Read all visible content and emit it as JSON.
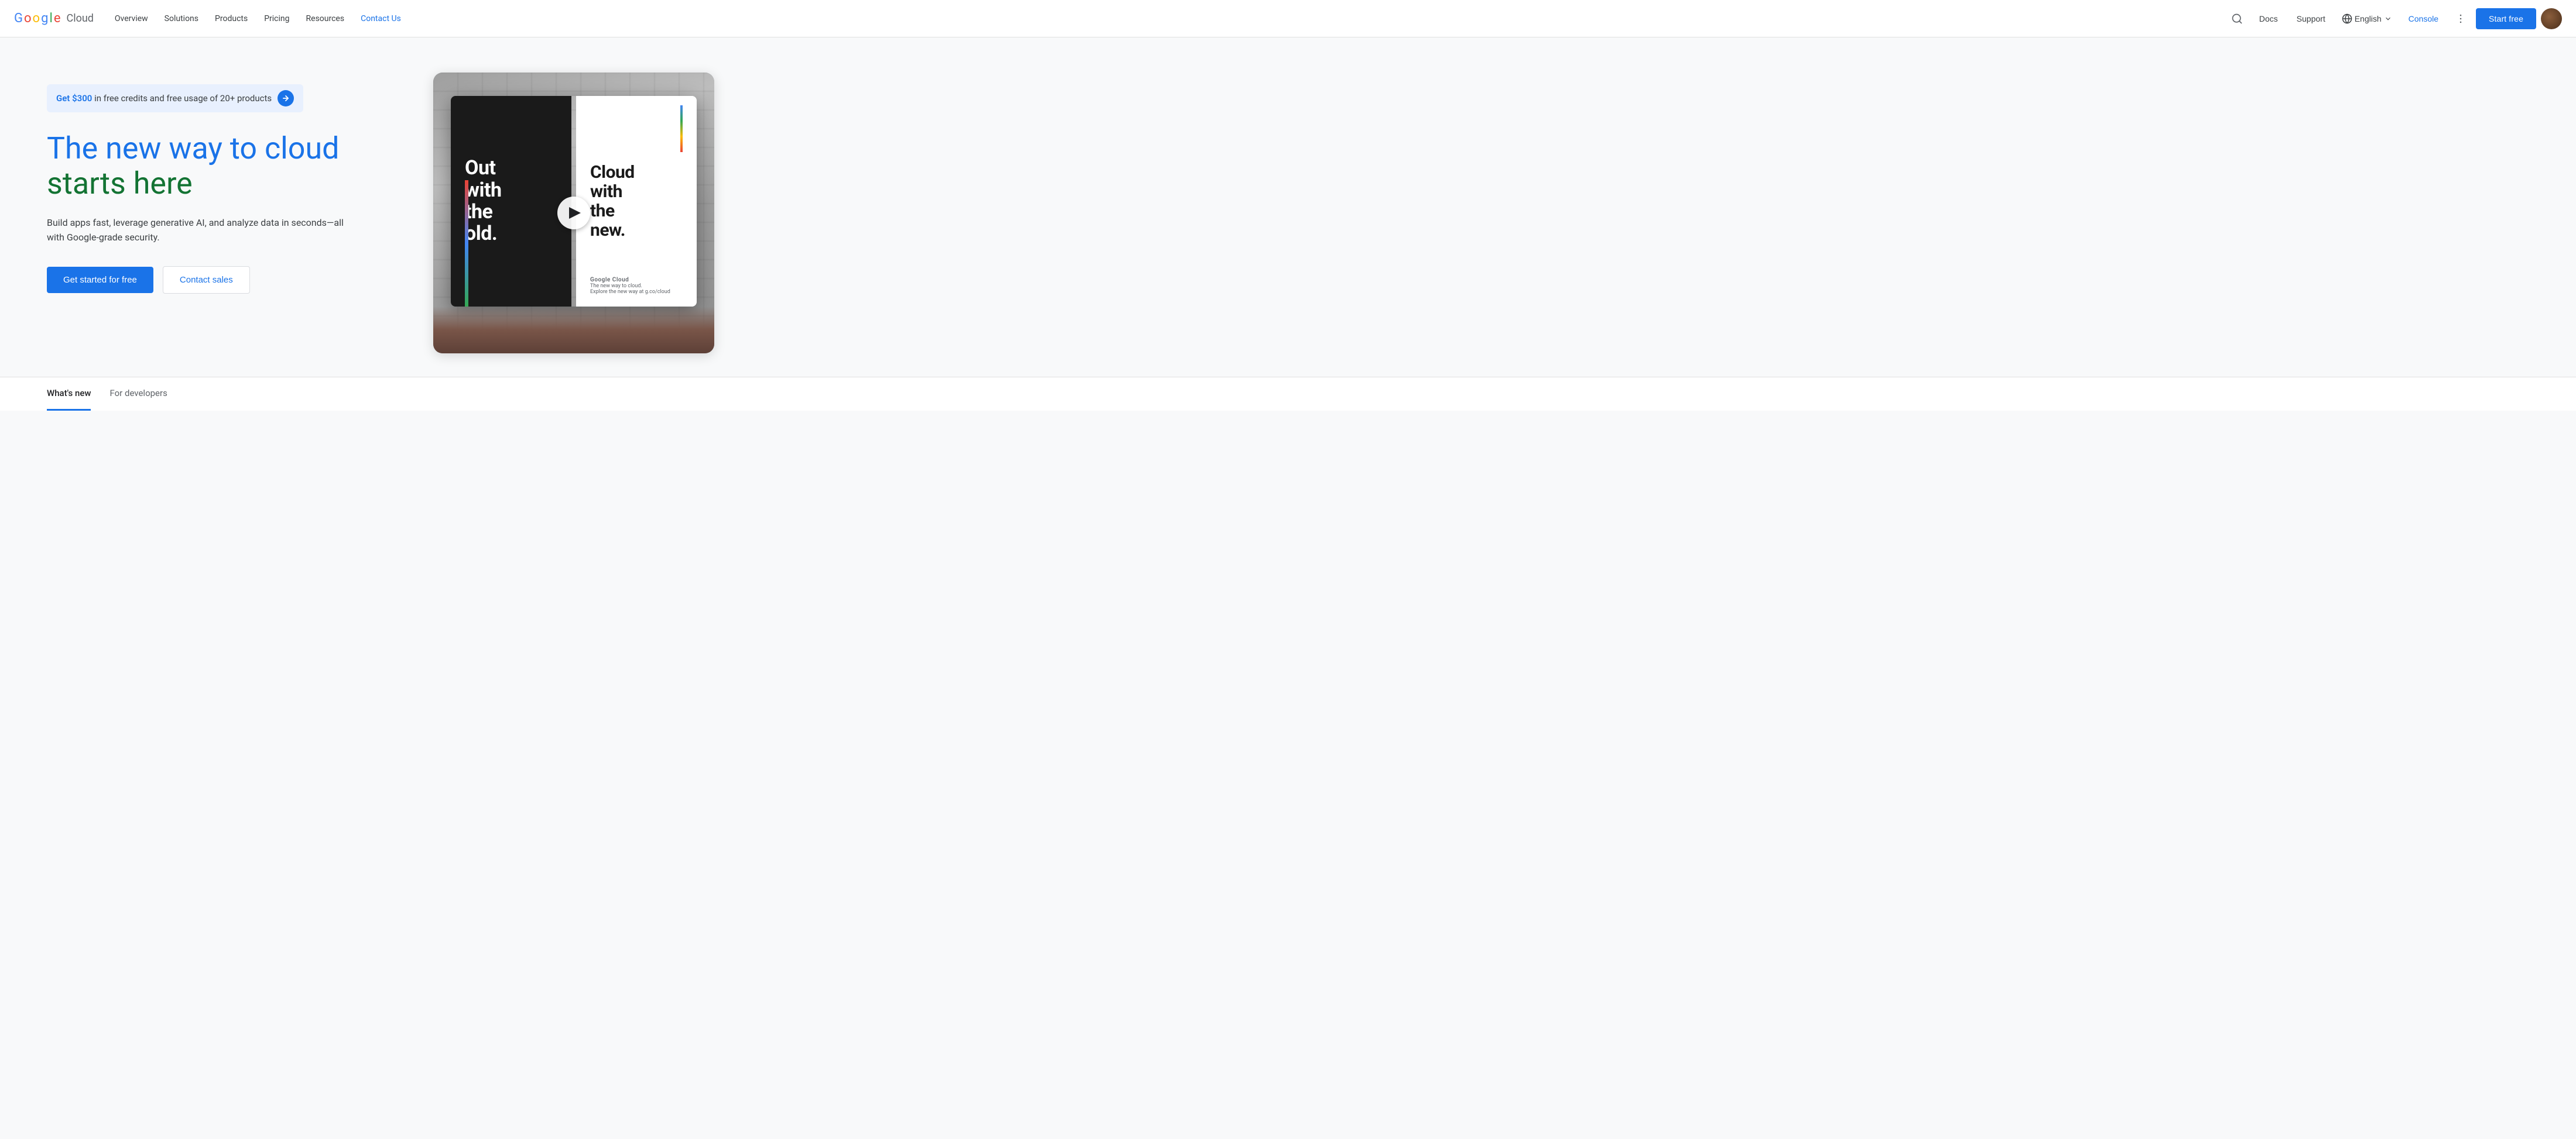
{
  "header": {
    "logo_google": "Google",
    "logo_cloud": "Cloud",
    "nav_items": [
      {
        "id": "overview",
        "label": "Overview"
      },
      {
        "id": "solutions",
        "label": "Solutions"
      },
      {
        "id": "products",
        "label": "Products"
      },
      {
        "id": "pricing",
        "label": "Pricing"
      },
      {
        "id": "resources",
        "label": "Resources"
      },
      {
        "id": "contact-us",
        "label": "Contact Us",
        "active": true
      }
    ],
    "search_label": "Search",
    "docs_label": "Docs",
    "support_label": "Support",
    "language": "English",
    "console_label": "Console",
    "more_label": "More",
    "start_free_label": "Start free"
  },
  "hero": {
    "promo_text_bold": "$300",
    "promo_text": " in free credits and free usage of 20+ products",
    "title_line1_blue": "The new way to cloud",
    "title_line2_green": "starts here",
    "subtitle": "Build apps fast, leverage generative AI, and analyze data in seconds—all with Google-grade security.",
    "cta_primary": "Get started for free",
    "cta_secondary": "Contact sales"
  },
  "tabs": [
    {
      "id": "whats-new",
      "label": "What's new",
      "active": true
    },
    {
      "id": "for-developers",
      "label": "For developers",
      "active": false
    }
  ],
  "billboard": {
    "left_line1": "Out",
    "left_line2": "with",
    "left_line3": "the",
    "left_line4": "old.",
    "right_line1": "Cloud",
    "right_line2": "with",
    "right_line3": "the",
    "right_line4": "new.",
    "footer_brand": "Google Cloud",
    "footer_tagline": "The new way to cloud.",
    "footer_sub": "Explore the new way at g.co/cloud"
  }
}
